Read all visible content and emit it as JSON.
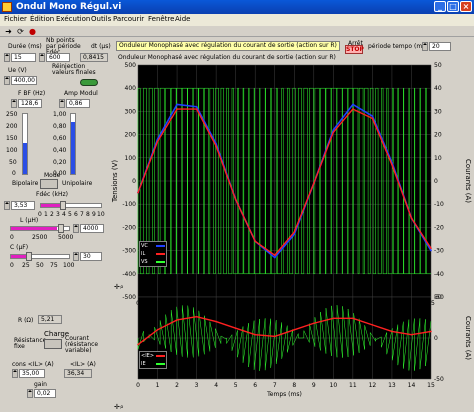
{
  "window": {
    "title": "Ondul Mono Régul.vi"
  },
  "menu": [
    "Fichier",
    "Édition",
    "Exécution",
    "Outils",
    "Parcourir",
    "Fenêtre",
    "Aide"
  ],
  "controls": {
    "duree_label": "Durée (ms)",
    "duree_value": "15",
    "nbpoints_label": "Nb points par période Fdéc",
    "nbpoints_value": "600",
    "dt_label": "dt (µs)",
    "dt_value": "0,8415",
    "reinjection_label": "Réinjection valeurs finales",
    "ue_label": "Ue (V)",
    "ue_value": "400,00",
    "fbf_label": "F BF (Hz)",
    "fbf_value": "128,6",
    "ampmodul_label": "Amp Modul",
    "ampmodul_value": "0,86",
    "fbf_ticks": [
      "250",
      "200",
      "150",
      "100",
      "50",
      "0"
    ],
    "ampmodul_ticks": [
      "1,00",
      "0,80",
      "0,60",
      "0,40",
      "0,20",
      "0,00"
    ],
    "fbf_level": 0.51,
    "ampmodul_level": 0.86,
    "mode_label": "Mode",
    "bipolaire_label": "Bipolaire",
    "unipolaire_label": "Unipolaire",
    "fdec_label": "Fdéc (kHz)",
    "fdec_value": "3,53",
    "fdec_ticks": [
      "0",
      "1",
      "2",
      "3",
      "4",
      "5",
      "6",
      "7",
      "8",
      "9",
      "10"
    ],
    "l_label": "L (µH)",
    "l_value": "4000",
    "l_ticks": [
      "0",
      "2500",
      "5000"
    ],
    "c_label": "C (µF)",
    "c_value": "30",
    "c_ticks": [
      "0",
      "25",
      "50",
      "75",
      "100"
    ],
    "r_label": "R (Ω)",
    "r_value": "5,21",
    "charge_label": "Charge",
    "resistance_fixe_label": "Résistance fixe",
    "courant_variable_label": "Courant (résistance variable)",
    "cons_il_label": "cons <IL> (A)",
    "cons_il_value": "35,00",
    "il_label": "<IL> (A)",
    "il_value": "36,34",
    "gain_label": "gain",
    "gain_value": "0,02"
  },
  "header_bar": {
    "graph_title": "Onduleur Monophasé avec régulation du courant de sortie (action sur R)",
    "arret_label": "Arrêt",
    "stop_label": "STOP",
    "periode_tempo_label": "période tempo (ms)",
    "periode_tempo_value": "20"
  },
  "graph1": {
    "yleft_label": "Tensions (V)",
    "yright_label": "Courants (A)",
    "xlabel": "Temps (ms)",
    "xticks": [
      "0",
      "1",
      "2",
      "3",
      "4",
      "5",
      "6",
      "7",
      "8",
      "9",
      "10",
      "11",
      "12",
      "13",
      "14",
      "15"
    ],
    "yleft_ticks": [
      "500",
      "400",
      "300",
      "200",
      "100",
      "0",
      "-100",
      "-200",
      "-300",
      "-400",
      "-500"
    ],
    "yright_ticks": [
      "50",
      "40",
      "30",
      "20",
      "10",
      "0",
      "-10",
      "-20",
      "-30",
      "-40",
      "-50"
    ],
    "legend": [
      "VC",
      "IL",
      "VS"
    ],
    "colors": {
      "vc": "#2040ff",
      "il": "#ff2020",
      "vs": "#30ff30",
      "bg": "#000000",
      "grid": "#808080"
    }
  },
  "graph2": {
    "xlabel": "Temps (ms)",
    "xticks": [
      "0",
      "1",
      "2",
      "3",
      "4",
      "5",
      "6",
      "7",
      "8",
      "9",
      "10",
      "11",
      "12",
      "13",
      "14",
      "15"
    ],
    "yright_label": "Courants (A)",
    "yright_ticks": [
      "50",
      "0",
      "-50"
    ],
    "legend": [
      "<IE>",
      "IE"
    ]
  },
  "chart_data": [
    {
      "type": "line",
      "xlabel": "Temps (ms)",
      "ylabel": "Tensions (V)",
      "y2label": "Courants (A)",
      "xlim": [
        0,
        15
      ],
      "ylim": [
        -500,
        500
      ],
      "y2lim": [
        -50,
        50
      ],
      "series": [
        {
          "name": "VC",
          "x": [
            0,
            1,
            2,
            3,
            4,
            5,
            6,
            7,
            8,
            9,
            10,
            11,
            12,
            13,
            14,
            15
          ],
          "values": [
            -50,
            180,
            330,
            320,
            160,
            -80,
            -260,
            -330,
            -230,
            -10,
            220,
            330,
            280,
            80,
            -160,
            -300
          ]
        },
        {
          "name": "IL",
          "x": [
            0,
            1,
            2,
            3,
            4,
            5,
            6,
            7,
            8,
            9,
            10,
            11,
            12,
            13,
            14,
            15
          ],
          "values": [
            -5,
            17,
            31,
            31,
            15,
            -8,
            -26,
            -32,
            -22,
            -1,
            21,
            31,
            27,
            7,
            -16,
            -29
          ]
        },
        {
          "name": "VS",
          "x": [
            0,
            15
          ],
          "values": [
            400,
            -400
          ]
        }
      ]
    },
    {
      "type": "line",
      "xlabel": "Temps (ms)",
      "ylabel": "Courants (A)",
      "xlim": [
        0,
        15
      ],
      "ylim": [
        -50,
        50
      ],
      "series": [
        {
          "name": "<IE>",
          "x": [
            0,
            1,
            2,
            3,
            4,
            5,
            6,
            7,
            8,
            9,
            10,
            11,
            12,
            13,
            14,
            15
          ],
          "values": [
            -8,
            10,
            22,
            26,
            20,
            12,
            4,
            2,
            10,
            18,
            24,
            24,
            16,
            8,
            4,
            8
          ]
        },
        {
          "name": "IE",
          "x": [
            0,
            15
          ],
          "values": [
            40,
            -40
          ]
        }
      ]
    }
  ]
}
